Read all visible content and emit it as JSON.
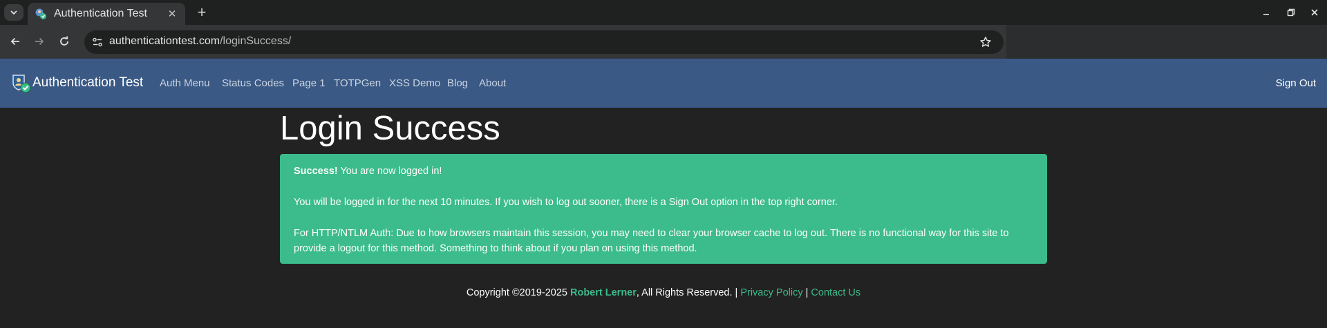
{
  "browser": {
    "tab_title": "Authentication Test",
    "tab_close": "✕",
    "new_tab": "+",
    "url_host": "authenticationtest.com",
    "url_path": "/loginSuccess/"
  },
  "navbar": {
    "brand": "Authentication Test",
    "links": [
      "Auth Menu",
      "Status Codes",
      "Page 1",
      "TOTPGen",
      "XSS Demo",
      "Blog",
      "About"
    ],
    "sign_out": "Sign Out"
  },
  "main": {
    "title": "Login Success",
    "alert": {
      "strong": "Success!",
      "line1_rest": " You are now logged in!",
      "line2": "You will be logged in for the next 10 minutes. If you wish to log out sooner, there is a Sign Out option in the top right corner.",
      "line3a": "For HTTP/NTLM Auth: Due to how browsers maintain this session, you may need to clear your browser cache to log out. There is no functional way for this site to",
      "line3b": "provide a logout for this method. Something to think about if you plan on using this method."
    }
  },
  "footer": {
    "copyright": "Copyright ©2019-2025 ",
    "author": "Robert Lerner",
    "rights": ", All Rights Reserved. | ",
    "privacy": "Privacy Policy",
    "sep": " | ",
    "contact": "Contact Us"
  },
  "colors": {
    "navbar": "#3a5a85",
    "alert": "#3cbb8c",
    "background": "#222222"
  }
}
